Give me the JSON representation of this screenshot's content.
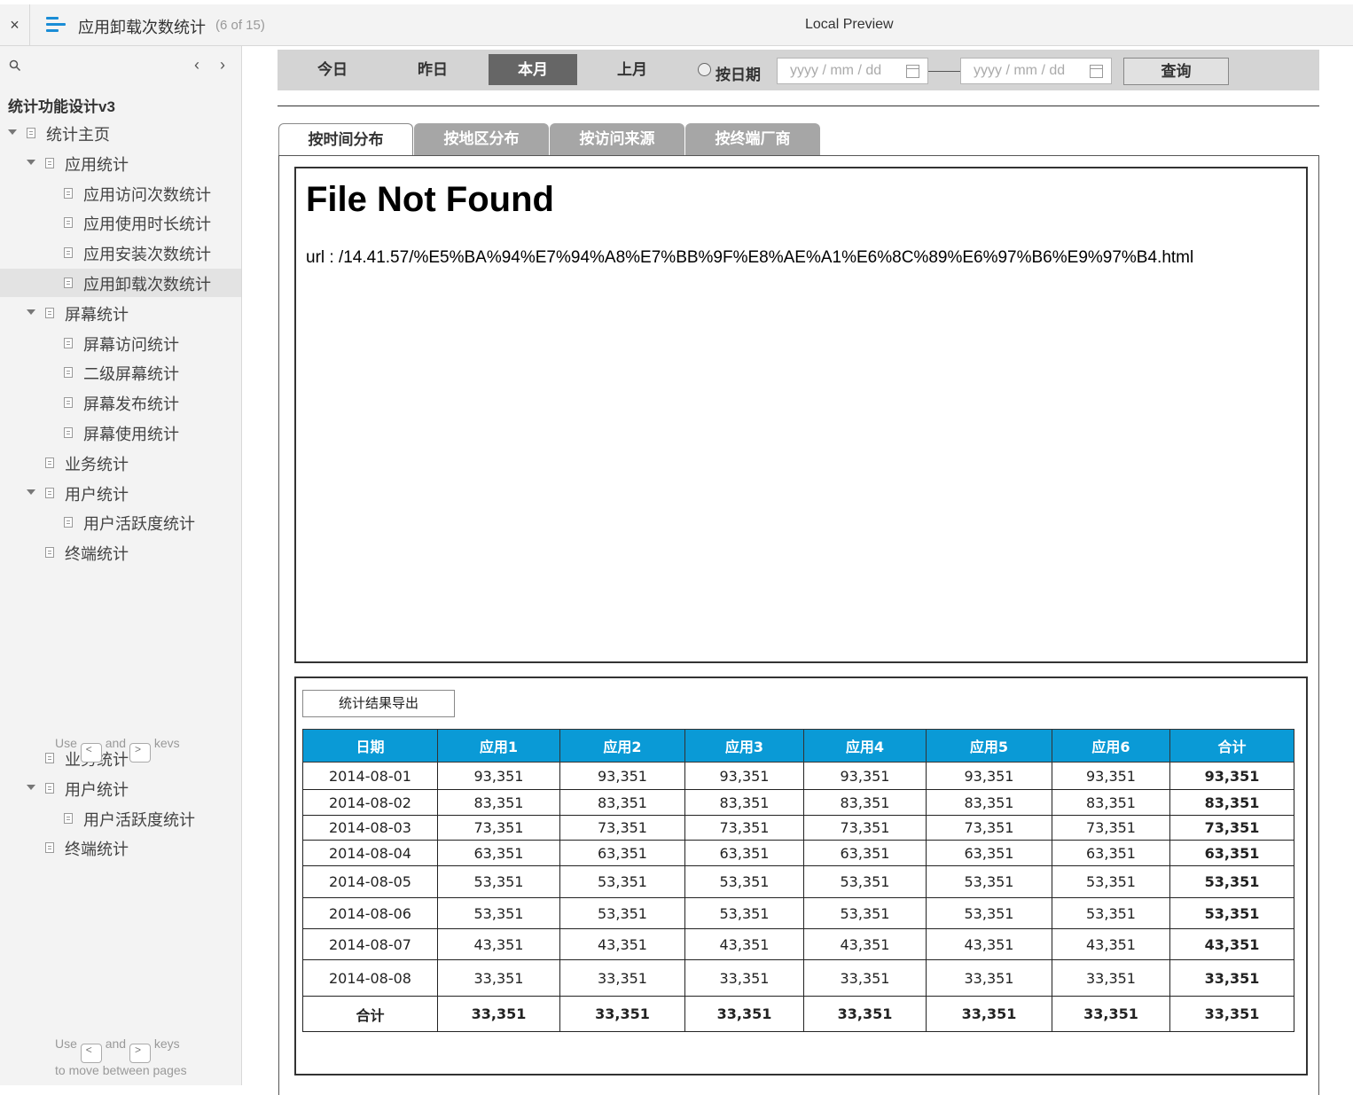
{
  "topbar": {
    "close": "×",
    "page_title": "应用卸载次数统计",
    "page_count": "(6 of 15)",
    "preview_title": "Local Preview"
  },
  "sidebar": {
    "prev": "‹",
    "next": "›",
    "project": "统计功能设计v3",
    "tree": [
      {
        "label": "统计主页",
        "indent": 0,
        "caret": true
      },
      {
        "label": "应用统计",
        "indent": 1,
        "caret": true
      },
      {
        "label": "应用访问次数统计",
        "indent": 2,
        "caret": false
      },
      {
        "label": "应用使用时长统计",
        "indent": 2,
        "caret": false
      },
      {
        "label": "应用安装次数统计",
        "indent": 2,
        "caret": false
      },
      {
        "label": "应用卸载次数统计",
        "indent": 2,
        "caret": false,
        "selected": true
      },
      {
        "label": "屏幕统计",
        "indent": 1,
        "caret": true
      },
      {
        "label": "屏幕访问统计",
        "indent": 2,
        "caret": false
      },
      {
        "label": "二级屏幕统计",
        "indent": 2,
        "caret": false
      },
      {
        "label": "屏幕发布统计",
        "indent": 2,
        "caret": false
      },
      {
        "label": "屏幕使用统计",
        "indent": 2,
        "caret": false
      },
      {
        "label": "业务统计",
        "indent": 1,
        "caret": false
      },
      {
        "label": "用户统计",
        "indent": 1,
        "caret": true
      },
      {
        "label": "用户活跃度统计",
        "indent": 2,
        "caret": false
      },
      {
        "label": "终端统计",
        "indent": 1,
        "caret": false
      }
    ],
    "ghost_tree": [
      {
        "label": "业务统计",
        "indent": 1,
        "caret": false
      },
      {
        "label": "用户统计",
        "indent": 1,
        "caret": true
      },
      {
        "label": "用户活跃度统计",
        "indent": 2,
        "caret": false
      },
      {
        "label": "终端统计",
        "indent": 1,
        "caret": false
      }
    ],
    "hint_use": "Use",
    "hint_and": "and",
    "hint_keys": "keys",
    "hint_keys_ghost": "kevs",
    "hint_move": "to move between pages",
    "key_prev": "<",
    "key_next": ">"
  },
  "filter": {
    "buttons": [
      "今日",
      "昨日",
      "本月",
      "上月"
    ],
    "active_index": 2,
    "by_date_label": "按日期",
    "date_placeholder": "yyyy / mm / dd",
    "query_label": "查询"
  },
  "tabs": {
    "items": [
      "按时间分布",
      "按地区分布",
      "按访问来源",
      "按终端厂商"
    ],
    "active_index": 0
  },
  "frame": {
    "heading": "File Not Found",
    "url_text": "url : /14.41.57/%E5%BA%94%E7%94%A8%E7%BB%9F%E8%AE%A1%E6%8C%89%E6%97%B6%E9%97%B4.html"
  },
  "result": {
    "export_label": "统计结果导出",
    "columns": [
      "日期",
      "应用1",
      "应用2",
      "应用3",
      "应用4",
      "应用5",
      "应用6",
      "合计"
    ],
    "rows": [
      [
        "2014-08-01",
        "93,351",
        "93,351",
        "93,351",
        "93,351",
        "93,351",
        "93,351",
        "93,351"
      ],
      [
        "2014-08-02",
        "83,351",
        "83,351",
        "83,351",
        "83,351",
        "83,351",
        "83,351",
        "83,351"
      ],
      [
        "2014-08-03",
        "73,351",
        "73,351",
        "73,351",
        "73,351",
        "73,351",
        "73,351",
        "73,351"
      ],
      [
        "2014-08-04",
        "63,351",
        "63,351",
        "63,351",
        "63,351",
        "63,351",
        "63,351",
        "63,351"
      ],
      [
        "2014-08-05",
        "53,351",
        "53,351",
        "53,351",
        "53,351",
        "53,351",
        "53,351",
        "53,351"
      ],
      [
        "2014-08-06",
        "53,351",
        "53,351",
        "53,351",
        "53,351",
        "53,351",
        "53,351",
        "53,351"
      ],
      [
        "2014-08-07",
        "43,351",
        "43,351",
        "43,351",
        "43,351",
        "43,351",
        "43,351",
        "43,351"
      ],
      [
        "2014-08-08",
        "33,351",
        "33,351",
        "33,351",
        "33,351",
        "33,351",
        "33,351",
        "33,351"
      ]
    ],
    "total_row": [
      "合计",
      "33,351",
      "33,351",
      "33,351",
      "33,351",
      "33,351",
      "33,351",
      "33,351"
    ]
  },
  "colors": {
    "accent": "#0a9ad6",
    "active_filter": "#666666",
    "inactive_tab": "#a6a6a6",
    "sidebar_bg": "#f3f3f3"
  }
}
